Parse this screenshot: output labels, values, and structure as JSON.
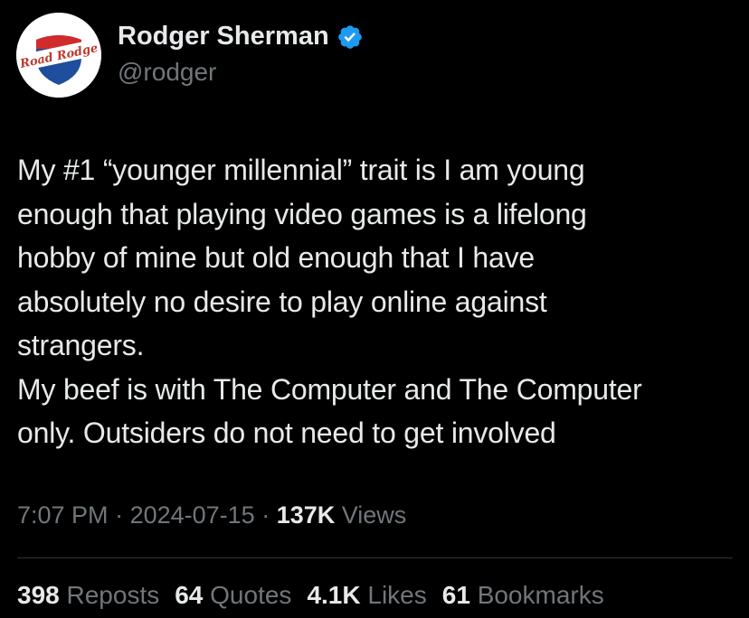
{
  "author": {
    "avatar_logo_text": "Road Rodge",
    "display_name": "Rodger Sherman",
    "handle": "@rodger",
    "verified_icon": "verified-badge-icon",
    "verified_color": "#1d9bf0"
  },
  "tweet": {
    "lines": [
      "My #1 “younger millennial” trait is I am young",
      "enough that playing video games is a lifelong",
      "hobby of mine but old enough that I have",
      "absolutely no desire to play online against",
      "strangers.",
      "My beef is with The Computer and The Computer",
      "only. Outsiders do not need to get involved"
    ]
  },
  "meta": {
    "time": "7:07 PM",
    "separator": " · ",
    "date": "2024-07-15",
    "views_count": "137K",
    "views_label": "Views"
  },
  "stats": {
    "reposts_count": "398",
    "reposts_label": "Reposts",
    "quotes_count": "64",
    "quotes_label": "Quotes",
    "likes_count": "4.1K",
    "likes_label": "Likes",
    "bookmarks_count": "61",
    "bookmarks_label": "Bookmarks"
  },
  "colors": {
    "background": "#000000",
    "primary_text": "#e7e9ea",
    "secondary_text": "#71767b",
    "divider": "#2f3336",
    "accent": "#1d9bf0"
  }
}
